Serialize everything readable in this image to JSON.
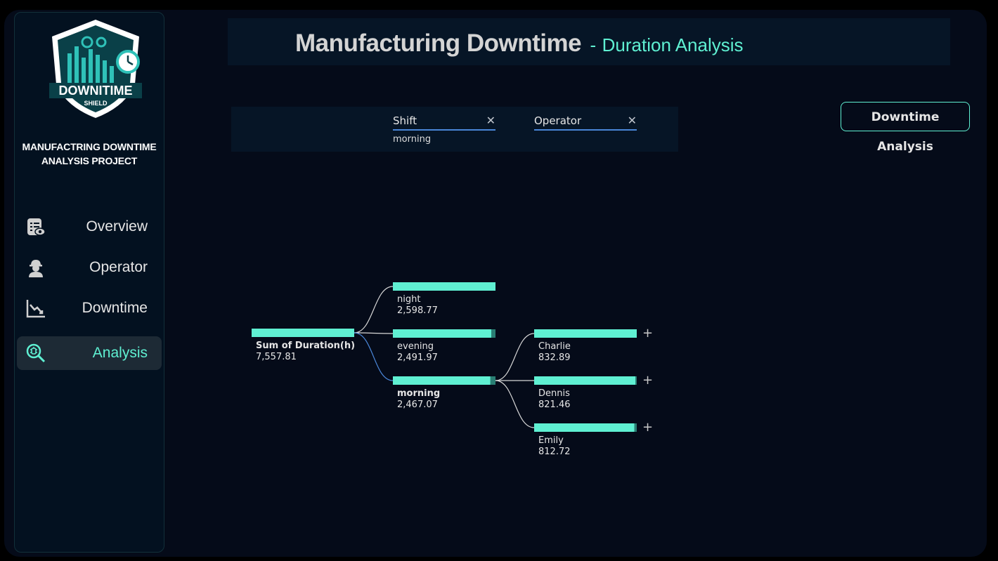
{
  "app": {
    "logo_text": "DOWNITIME",
    "logo_subtext": "SHIELD",
    "project_title_line1": "MANUFACTRING DOWNTIME",
    "project_title_line2": "ANALYSIS PROJECT"
  },
  "sidebar": {
    "items": [
      {
        "label": "Overview",
        "icon": "overview-report-icon",
        "active": false
      },
      {
        "label": "Operator",
        "icon": "operator-icon",
        "active": false
      },
      {
        "label": "Downtime",
        "icon": "downtime-chart-icon",
        "active": false
      },
      {
        "label": "Analysis",
        "icon": "analysis-search-icon",
        "active": true
      }
    ]
  },
  "header": {
    "title": "Manufacturing Downtime",
    "separator": "-",
    "subtitle": "Duration Analysis"
  },
  "filters": [
    {
      "label": "Shift",
      "value": "morning",
      "clear_icon": "close-icon"
    },
    {
      "label": "Operator",
      "value": "",
      "clear_icon": "close-icon"
    }
  ],
  "nav_button": {
    "label": "Downtime Analysis"
  },
  "colors": {
    "accent": "#5ff0d2",
    "background": "#050b19",
    "panel": "#061526",
    "connector_selected": "#4a86d8"
  },
  "chart_data": {
    "type": "decomposition-tree",
    "root": {
      "label": "Sum of Duration(h)",
      "value": 7557.81,
      "display": "7,557.81"
    },
    "levels": [
      {
        "field": "Shift",
        "nodes": [
          {
            "label": "night",
            "value": 2598.77,
            "display": "2,598.77",
            "selected": false
          },
          {
            "label": "evening",
            "value": 2491.97,
            "display": "2,491.97",
            "selected": false
          },
          {
            "label": "morning",
            "value": 2467.07,
            "display": "2,467.07",
            "selected": true
          }
        ]
      },
      {
        "field": "Operator",
        "parent": "morning",
        "nodes": [
          {
            "label": "Charlie",
            "value": 832.89,
            "display": "832.89",
            "expandable": true
          },
          {
            "label": "Dennis",
            "value": 821.46,
            "display": "821.46",
            "expandable": true
          },
          {
            "label": "Emily",
            "value": 812.72,
            "display": "812.72",
            "expandable": true
          }
        ]
      }
    ],
    "expand_symbol": "+"
  }
}
